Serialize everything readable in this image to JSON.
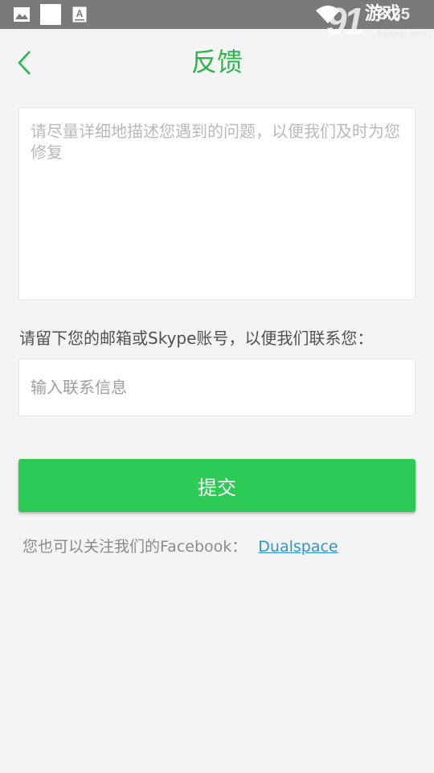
{
  "status_bar": {
    "time": "3:35",
    "icons": [
      "image-icon",
      "square-icon",
      "font-icon",
      "wifi-icon"
    ],
    "watermark": {
      "brand": "91",
      "brand_text": "游戏",
      "site": "91danji.com"
    }
  },
  "header": {
    "back_icon": "chevron-left-icon",
    "title": "反馈"
  },
  "form": {
    "feedback_placeholder": "请尽量详细地描述您遇到的问题，以便我们及时为您修复",
    "contact_label": "请留下您的邮箱或Skype账号，以便我们联系您：",
    "contact_placeholder": "输入联系信息",
    "submit_label": "提交"
  },
  "footer": {
    "facebook_text": "您也可以关注我们的Facebook：",
    "facebook_link": "Dualspace"
  },
  "colors": {
    "accent": "#2db44a",
    "button": "#2dca55",
    "link": "#2b95d6",
    "status_bar": "#7a7a7a",
    "background": "#f4f4f4"
  }
}
